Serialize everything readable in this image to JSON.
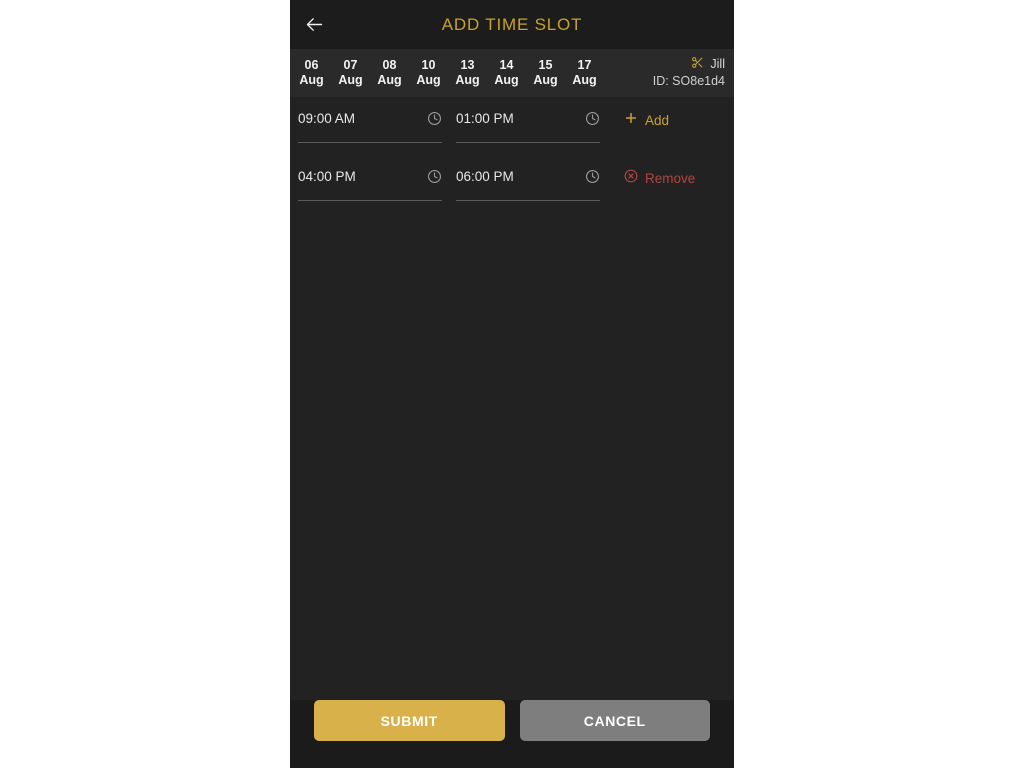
{
  "appbar": {
    "back_icon": "arrow-left-icon",
    "title": "ADD TIME SLOT",
    "title_color": "#c9a22b"
  },
  "datebar": {
    "chips": [
      {
        "day": "06",
        "month": "Aug"
      },
      {
        "day": "07",
        "month": "Aug"
      },
      {
        "day": "08",
        "month": "Aug"
      },
      {
        "day": "10",
        "month": "Aug"
      },
      {
        "day": "13",
        "month": "Aug"
      },
      {
        "day": "14",
        "month": "Aug"
      },
      {
        "day": "15",
        "month": "Aug"
      },
      {
        "day": "17",
        "month": "Aug"
      }
    ],
    "staff": {
      "icon": "scissors-icon",
      "name": "Jill",
      "id_label": "ID: SO8e1d4"
    }
  },
  "slots": [
    {
      "start": {
        "value": "09:00 AM",
        "icon": "clock-icon"
      },
      "end": {
        "value": "01:00 PM",
        "icon": "clock-icon"
      },
      "action": {
        "label": "Add",
        "icon": "plus-icon",
        "color": "#c9a22b"
      }
    },
    {
      "start": {
        "value": "04:00 PM",
        "icon": "clock-icon"
      },
      "end": {
        "value": "06:00 PM",
        "icon": "clock-icon"
      },
      "action": {
        "label": "Remove",
        "icon": "circle-x-icon",
        "color": "#b2453f"
      }
    }
  ],
  "footer": {
    "submit_label": "SUBMIT",
    "submit_color": "#d9b14a",
    "cancel_label": "CANCEL",
    "cancel_color": "#7e7e7e"
  }
}
